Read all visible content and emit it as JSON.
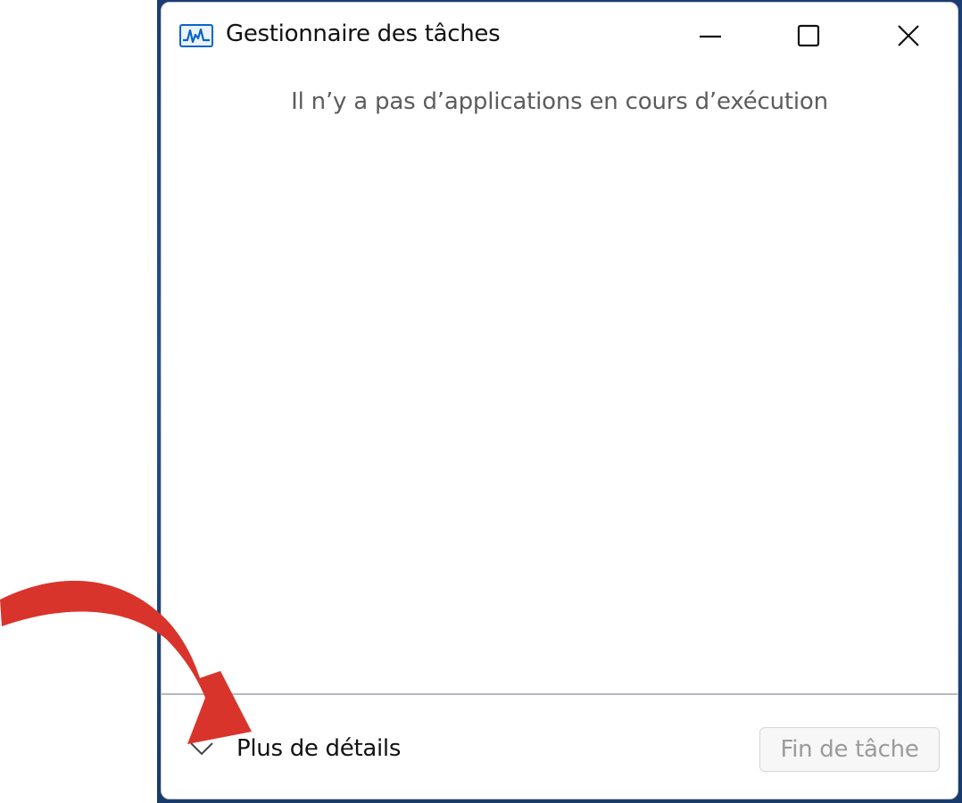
{
  "window": {
    "title": "Gestionnaire des tâches",
    "icon": "task-manager-icon"
  },
  "caption_buttons": {
    "minimize_icon": "minimize-icon",
    "maximize_icon": "maximize-icon",
    "close_icon": "close-icon"
  },
  "main": {
    "empty_message": "Il n’y a pas d’applications en cours d’exécution"
  },
  "footer": {
    "more_details_label": "Plus de détails",
    "more_details_icon": "chevron-down-icon",
    "end_task_label": "Fin de tâche",
    "end_task_enabled": false
  },
  "annotation": {
    "arrow_icon": "curved-arrow-icon",
    "arrow_color": "#d9342b"
  },
  "colors": {
    "accent": "#0a64c8",
    "wallpaper": "#24508f"
  }
}
